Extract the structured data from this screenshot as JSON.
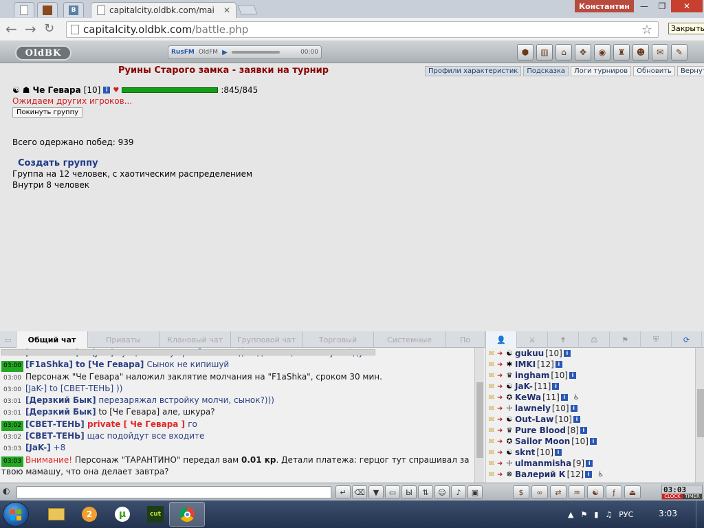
{
  "browser": {
    "tab_title": "capitalcity.oldbk.com/mai",
    "user": "Константин",
    "url_host": "capitalcity.oldbk.com",
    "url_path": "/battle.php",
    "close_tooltip": "Закрыть"
  },
  "game_header": {
    "logo": "OldBK",
    "radio_rus": "RusFM",
    "radio_old": "OldFM",
    "radio_time": "00:00"
  },
  "page": {
    "title": "Руины Старого замка - заявки на турнир",
    "buttons": [
      "Профили характеристик",
      "Подсказка",
      "Логи турниров",
      "Обновить",
      "Вернуться"
    ],
    "player_name": "Че Гевара",
    "player_level": "[10]",
    "hp": ":845/845",
    "hp_fraction": 1.0,
    "waiting": "Ожидаем других игроков...",
    "leave_button": "Покинуть группу",
    "wins": "Всего одержано побед: 939",
    "create_group": "Создать группу",
    "group_desc": "Группа на 12 человек, с хаотическим распределением",
    "group_inside": "Внутри 8 человек"
  },
  "chat": {
    "tabs": [
      "Общий чат",
      "Приваты",
      "Клановый чат",
      "Групповой чат",
      "Торговый",
      "Системные",
      "По"
    ],
    "lines": [
      {
        "ts": "03:00",
        "hl": false,
        "parts": [
          [
            "nick",
            "[СВЕТ-ТЕНЬ]"
          ],
          [
            "nick",
            " to [JaK-] "
          ],
          [
            "nick",
            "ну щас начнут разбегаться )) сидим .. щас позову пойду"
          ]
        ]
      },
      {
        "ts": "03:00",
        "hl": true,
        "parts": [
          [
            "nickb",
            "[F1aShka]"
          ],
          [
            "nickb",
            " to [Че Гевара] "
          ],
          [
            "nick",
            "Сынок не кипишуй"
          ]
        ]
      },
      {
        "ts": "03:00",
        "hl": false,
        "parts": [
          [
            "text",
            "Персонаж \"Че Гевара\" наложил заклятие молчания на \"F1aShka\", сроком 30 мин."
          ]
        ]
      },
      {
        "ts": "03:00",
        "hl": false,
        "parts": [
          [
            "nick",
            "[JaK-]"
          ],
          [
            "nick",
            " to [СВЕТ-ТЕНЬ] "
          ],
          [
            "nick",
            "))"
          ]
        ]
      },
      {
        "ts": "03:01",
        "hl": false,
        "parts": [
          [
            "nickb",
            "[Дерзкий Бык]"
          ],
          [
            "nick",
            " перезаряжал встройку молчи, сынок?)))"
          ]
        ]
      },
      {
        "ts": "03:01",
        "hl": false,
        "parts": [
          [
            "nickb",
            "[Дерзкий Бык]"
          ],
          [
            "text",
            " to [Че Гевара] "
          ],
          [
            "text",
            "але, шкура?"
          ]
        ]
      },
      {
        "ts": "03:02",
        "hl": true,
        "parts": [
          [
            "nickb",
            "[СВЕТ-ТЕНЬ]"
          ],
          [
            "priv",
            " private [ Че Гевара ] "
          ],
          [
            "nick",
            "го"
          ]
        ]
      },
      {
        "ts": "03:02",
        "hl": false,
        "parts": [
          [
            "nickb",
            "[СВЕТ-ТЕНЬ]"
          ],
          [
            "nick",
            " щас подойдут все входите"
          ]
        ]
      },
      {
        "ts": "03:03",
        "hl": false,
        "parts": [
          [
            "nickb",
            "[JaK-]"
          ],
          [
            "nick",
            " +8"
          ]
        ]
      },
      {
        "ts": "03:03",
        "hl": true,
        "parts": [
          [
            "warn",
            "Внимание!"
          ],
          [
            "text",
            " Персонаж \"ТАРАНТИНО\" передал вам "
          ],
          [
            "bold",
            "0.01 кр"
          ],
          [
            "text",
            ". Детали платежа: герцог тут спрашивал за"
          ]
        ]
      },
      {
        "ts": "",
        "hl": false,
        "parts": [
          [
            "text",
            "твою мамашу, что она делает завтра?"
          ]
        ]
      }
    ]
  },
  "online": {
    "players": [
      {
        "name": "gukuu",
        "level": "[10]"
      },
      {
        "name": "IMKI",
        "level": "[12]"
      },
      {
        "name": "ingham",
        "level": "[10]"
      },
      {
        "name": "JaK-",
        "level": "[11]"
      },
      {
        "name": "KeWa",
        "level": "[11]"
      },
      {
        "name": "lawnely",
        "level": "[10]"
      },
      {
        "name": "Out-Law",
        "level": "[10]"
      },
      {
        "name": "Pure Blood",
        "level": "[8]"
      },
      {
        "name": "Sailor Moon",
        "level": "[10]"
      },
      {
        "name": "sknt",
        "level": "[10]"
      },
      {
        "name": "ulmanmisha",
        "level": "[9]"
      },
      {
        "name": "Валерий К",
        "level": "[12]"
      }
    ]
  },
  "clock_widget": {
    "time": "03:03",
    "clock_label": "CLOCK",
    "timer_label": "TIMER"
  },
  "taskbar": {
    "lang": "РУС",
    "time": "3:03"
  }
}
